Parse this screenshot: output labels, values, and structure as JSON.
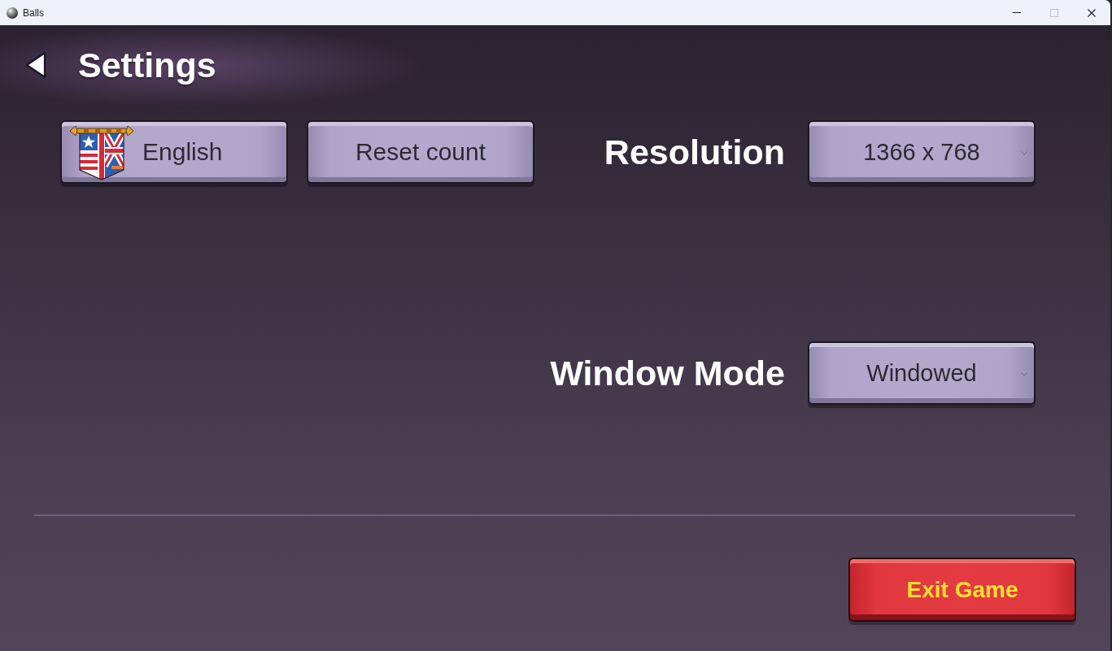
{
  "window": {
    "title": "Balls",
    "controls": [
      {
        "kind": "minimize",
        "disabled": false
      },
      {
        "kind": "maximize",
        "disabled": true
      },
      {
        "kind": "close",
        "disabled": false
      }
    ]
  },
  "header": {
    "title": "Settings"
  },
  "buttons": [
    {
      "kind": "language",
      "label": "English"
    },
    {
      "kind": "plain",
      "label": "Reset count"
    }
  ],
  "settings": [
    {
      "label": "Resolution",
      "value": "1366 x 768"
    },
    {
      "label": "Window Mode",
      "value": "Windowed"
    }
  ],
  "exit_button": {
    "label": "Exit Game"
  }
}
